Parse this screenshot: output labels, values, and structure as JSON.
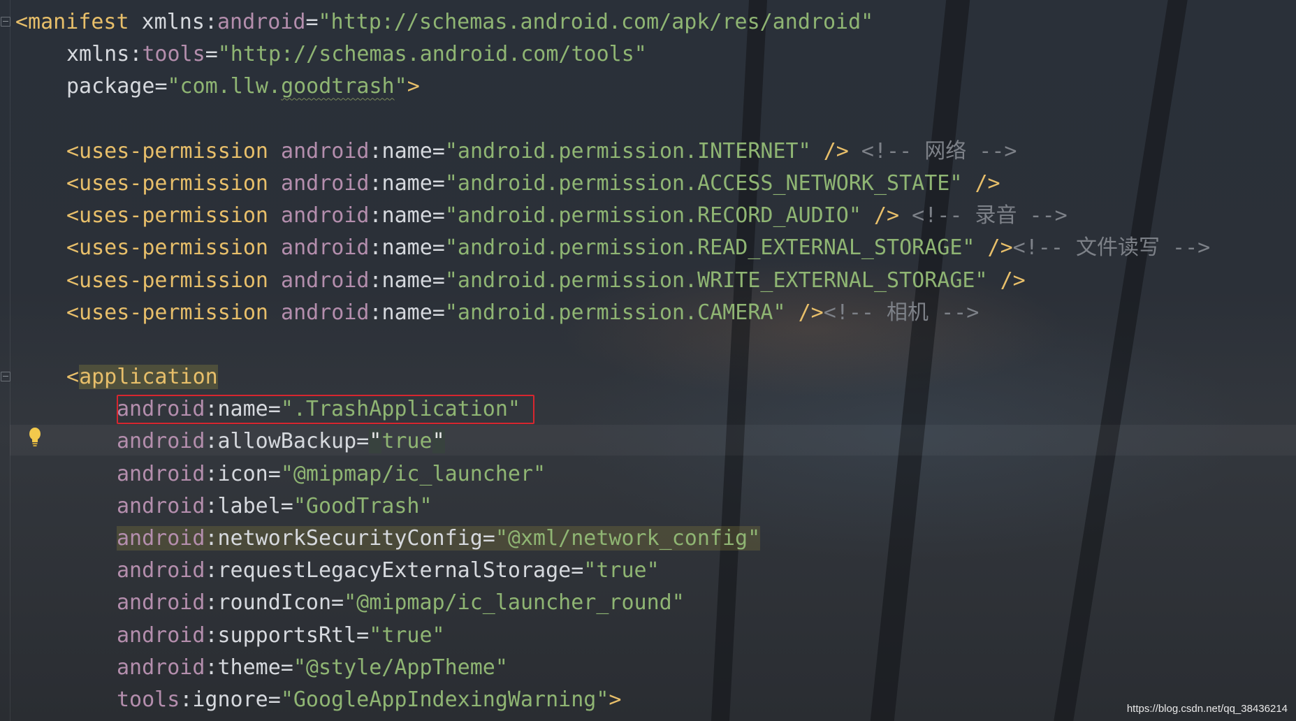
{
  "editor": {
    "lines": [
      {
        "parts": [
          {
            "t": "<manifest ",
            "c": "tag"
          },
          {
            "t": "xmlns",
            "c": "attr"
          },
          {
            "t": ":",
            "c": "attr"
          },
          {
            "t": "android",
            "c": "ns"
          },
          {
            "t": "=",
            "c": "attr"
          },
          {
            "t": "\"http://schemas.android.com/apk/res/android\"",
            "c": "val"
          }
        ]
      },
      {
        "parts": [
          {
            "t": "xmlns",
            "c": "attr"
          },
          {
            "t": ":",
            "c": "attr"
          },
          {
            "t": "tools",
            "c": "ns"
          },
          {
            "t": "=",
            "c": "attr"
          },
          {
            "t": "\"http://schemas.android.com/tools\"",
            "c": "val"
          }
        ]
      },
      {
        "parts": [
          {
            "t": "package",
            "c": "attr"
          },
          {
            "t": "=",
            "c": "attr"
          },
          {
            "t": "\"com.llw.",
            "c": "val"
          },
          {
            "t": "goodtrash",
            "c": "val squiggle"
          },
          {
            "t": "\"",
            "c": "val"
          },
          {
            "t": ">",
            "c": "tag"
          }
        ]
      },
      {
        "parts": []
      },
      {
        "parts": [
          {
            "t": "<uses-permission ",
            "c": "tag"
          },
          {
            "t": "android",
            "c": "ns"
          },
          {
            "t": ":name=",
            "c": "attr"
          },
          {
            "t": "\"android.permission.INTERNET\"",
            "c": "val"
          },
          {
            "t": " />",
            "c": "tag"
          },
          {
            "t": " <!-- 网络 -->",
            "c": "cmt"
          }
        ]
      },
      {
        "parts": [
          {
            "t": "<uses-permission ",
            "c": "tag"
          },
          {
            "t": "android",
            "c": "ns"
          },
          {
            "t": ":name=",
            "c": "attr"
          },
          {
            "t": "\"android.permission.ACCESS_NETWORK_STATE\"",
            "c": "val"
          },
          {
            "t": " />",
            "c": "tag"
          }
        ]
      },
      {
        "parts": [
          {
            "t": "<uses-permission ",
            "c": "tag"
          },
          {
            "t": "android",
            "c": "ns"
          },
          {
            "t": ":name=",
            "c": "attr"
          },
          {
            "t": "\"android.permission.RECORD_AUDIO\"",
            "c": "val"
          },
          {
            "t": " />",
            "c": "tag"
          },
          {
            "t": " <!-- 录音 -->",
            "c": "cmt"
          }
        ]
      },
      {
        "parts": [
          {
            "t": "<uses-permission ",
            "c": "tag"
          },
          {
            "t": "android",
            "c": "ns"
          },
          {
            "t": ":name=",
            "c": "attr"
          },
          {
            "t": "\"android.permission.READ_EXTERNAL_STORAGE\"",
            "c": "val"
          },
          {
            "t": " />",
            "c": "tag"
          },
          {
            "t": "<!-- 文件读写 -->",
            "c": "cmt"
          }
        ]
      },
      {
        "parts": [
          {
            "t": "<uses-permission ",
            "c": "tag"
          },
          {
            "t": "android",
            "c": "ns"
          },
          {
            "t": ":name=",
            "c": "attr"
          },
          {
            "t": "\"android.permission.WRITE_EXTERNAL_STORAGE\"",
            "c": "val"
          },
          {
            "t": " />",
            "c": "tag"
          }
        ]
      },
      {
        "parts": [
          {
            "t": "<uses-permission ",
            "c": "tag"
          },
          {
            "t": "android",
            "c": "ns"
          },
          {
            "t": ":name=",
            "c": "attr"
          },
          {
            "t": "\"android.permission.CAMERA\"",
            "c": "val"
          },
          {
            "t": " />",
            "c": "tag"
          },
          {
            "t": "<!-- 相机 -->",
            "c": "cmt"
          }
        ]
      },
      {
        "parts": []
      },
      {
        "parts": [
          {
            "t": "<",
            "c": "tag"
          },
          {
            "t": "application",
            "c": "tag hlapp"
          }
        ]
      },
      {
        "parts": [
          {
            "t": "android",
            "c": "ns"
          },
          {
            "t": ":name=",
            "c": "attr"
          },
          {
            "t": "\".TrashApplication\"",
            "c": "val"
          }
        ]
      },
      {
        "parts": [
          {
            "t": "android",
            "c": "ns"
          },
          {
            "t": ":allowBackup=",
            "c": "attr"
          },
          {
            "t": "\"",
            "c": "val hlq"
          },
          {
            "t": "true",
            "c": "val"
          },
          {
            "t": "\"",
            "c": "val hlq"
          }
        ]
      },
      {
        "parts": [
          {
            "t": "android",
            "c": "ns"
          },
          {
            "t": ":icon=",
            "c": "attr"
          },
          {
            "t": "\"@mipmap/ic_launcher\"",
            "c": "val"
          }
        ]
      },
      {
        "parts": [
          {
            "t": "android",
            "c": "ns"
          },
          {
            "t": ":label=",
            "c": "attr"
          },
          {
            "t": "\"GoodTrash\"",
            "c": "val"
          }
        ]
      },
      {
        "parts": [
          {
            "t": "android",
            "c": "ns hlnet"
          },
          {
            "t": ":networkSecurityConfig=",
            "c": "attr hlnet"
          },
          {
            "t": "\"@xml/network_config\"",
            "c": "val hlnet"
          }
        ]
      },
      {
        "parts": [
          {
            "t": "android",
            "c": "ns"
          },
          {
            "t": ":requestLegacyExternalStorage=",
            "c": "attr"
          },
          {
            "t": "\"true\"",
            "c": "val"
          }
        ]
      },
      {
        "parts": [
          {
            "t": "android",
            "c": "ns"
          },
          {
            "t": ":roundIcon=",
            "c": "attr"
          },
          {
            "t": "\"@mipmap/ic_launcher_round\"",
            "c": "val"
          }
        ]
      },
      {
        "parts": [
          {
            "t": "android",
            "c": "ns"
          },
          {
            "t": ":supportsRtl=",
            "c": "attr"
          },
          {
            "t": "\"true\"",
            "c": "val"
          }
        ]
      },
      {
        "parts": [
          {
            "t": "android",
            "c": "ns"
          },
          {
            "t": ":theme=",
            "c": "attr"
          },
          {
            "t": "\"@style/AppTheme\"",
            "c": "val"
          }
        ]
      },
      {
        "parts": [
          {
            "t": "tools",
            "c": "ns"
          },
          {
            "t": ":ignore=",
            "c": "attr"
          },
          {
            "t": "\"GoogleAppIndexingWarning\"",
            "c": "val"
          },
          {
            "t": ">",
            "c": "tag"
          }
        ]
      }
    ],
    "indent": [
      "i0",
      "i1",
      "i1",
      "i1",
      "i1",
      "i1",
      "i1",
      "i1",
      "i1",
      "i1",
      "i1",
      "i1",
      "i2",
      "i2",
      "i2",
      "i2",
      "i2",
      "i2",
      "i2",
      "i2",
      "i2",
      "i2"
    ]
  },
  "watermark": "https://blog.csdn.net/qq_38436214",
  "colors": {
    "tag": "#e8bf6a",
    "namespace": "#b48ead",
    "value": "#8fb573",
    "comment": "#7d8188",
    "highlight_box": "#d7262f"
  },
  "icons": {
    "intention_bulb": "lightbulb-icon"
  }
}
